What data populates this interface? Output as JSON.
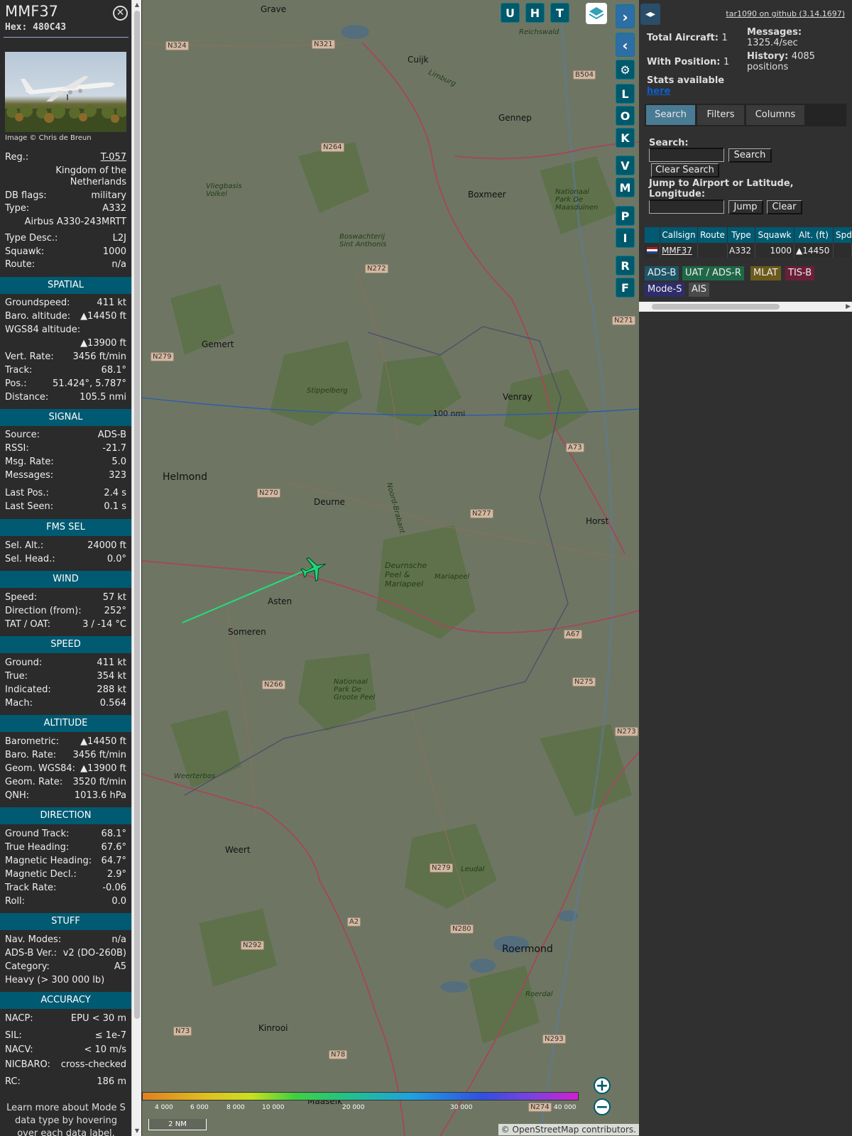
{
  "aircraft": {
    "callsign": "MMF37",
    "hex": "Hex: 480C43",
    "photo_credit": "Image © Chris de Breun"
  },
  "info": {
    "reg": {
      "label": "Reg.:",
      "value": "T-057"
    },
    "country": "Kingdom of the Netherlands",
    "db_flags": {
      "label": "DB flags:",
      "value": "military"
    },
    "type": {
      "label": "Type:",
      "value": "A332"
    },
    "type_full": "Airbus A330-243MRTT",
    "type_desc": {
      "label": "Type Desc.:",
      "value": "L2J"
    },
    "squawk": {
      "label": "Squawk:",
      "value": "1000"
    },
    "route": {
      "label": "Route:",
      "value": "n/a"
    }
  },
  "sections": {
    "spatial": "SPATIAL",
    "signal": "SIGNAL",
    "fms": "FMS SEL",
    "wind": "WIND",
    "speed": "SPEED",
    "altitude": "ALTITUDE",
    "direction": "DIRECTION",
    "stuff": "STUFF",
    "accuracy": "ACCURACY"
  },
  "spatial": {
    "groundspeed": {
      "label": "Groundspeed:",
      "value": "411 kt"
    },
    "baro_alt": {
      "label": "Baro. altitude:",
      "value": "▲14450 ft"
    },
    "wgs84_label": "WGS84 altitude:",
    "wgs84_value": "▲13900 ft",
    "vert_rate": {
      "label": "Vert. Rate:",
      "value": "3456 ft/min"
    },
    "track": {
      "label": "Track:",
      "value": "68.1°"
    },
    "pos": {
      "label": "Pos.:",
      "value": "51.424°, 5.787°"
    },
    "distance": {
      "label": "Distance:",
      "value": "105.5 nmi"
    }
  },
  "signal": {
    "source": {
      "label": "Source:",
      "value": "ADS-B"
    },
    "rssi": {
      "label": "RSSI:",
      "value": "-21.7"
    },
    "msg_rate": {
      "label": "Msg. Rate:",
      "value": "5.0"
    },
    "messages": {
      "label": "Messages:",
      "value": "323"
    },
    "last_pos": {
      "label": "Last Pos.:",
      "value": "2.4 s"
    },
    "last_seen": {
      "label": "Last Seen:",
      "value": "0.1 s"
    }
  },
  "fms": {
    "sel_alt": {
      "label": "Sel. Alt.:",
      "value": "24000 ft"
    },
    "sel_head": {
      "label": "Sel. Head.:",
      "value": "0.0°"
    }
  },
  "wind": {
    "speed": {
      "label": "Speed:",
      "value": "57 kt"
    },
    "direction": {
      "label": "Direction (from):",
      "value": "252°"
    },
    "tat_oat": {
      "label": "TAT / OAT:",
      "value": "3 / -14 °C"
    }
  },
  "speed": {
    "ground": {
      "label": "Ground:",
      "value": "411 kt"
    },
    "true": {
      "label": "True:",
      "value": "354 kt"
    },
    "indicated": {
      "label": "Indicated:",
      "value": "288 kt"
    },
    "mach": {
      "label": "Mach:",
      "value": "0.564"
    }
  },
  "altitude": {
    "barometric": {
      "label": "Barometric:",
      "value": "▲14450 ft"
    },
    "baro_rate": {
      "label": "Baro. Rate:",
      "value": "3456 ft/min"
    },
    "geom_wgs84": {
      "label": "Geom. WGS84:",
      "value": "▲13900 ft"
    },
    "geom_rate": {
      "label": "Geom. Rate:",
      "value": "3520 ft/min"
    },
    "qnh": {
      "label": "QNH:",
      "value": "1013.6 hPa"
    }
  },
  "direction": {
    "ground_track": {
      "label": "Ground Track:",
      "value": "68.1°"
    },
    "true_heading": {
      "label": "True Heading:",
      "value": "67.6°"
    },
    "mag_heading": {
      "label": "Magnetic Heading:",
      "value": "64.7°"
    },
    "mag_decl": {
      "label": "Magnetic Decl.:",
      "value": "2.9°"
    },
    "track_rate": {
      "label": "Track Rate:",
      "value": "-0.06"
    },
    "roll": {
      "label": "Roll:",
      "value": "0.0"
    }
  },
  "stuff": {
    "nav_modes": {
      "label": "Nav. Modes:",
      "value": "n/a"
    },
    "adsb_ver": {
      "label": "ADS-B Ver.:",
      "value": "v2 (DO-260B)"
    },
    "category": {
      "label": "Category:",
      "value": "A5"
    },
    "category_desc": "Heavy (> 300 000 lb)"
  },
  "accuracy": {
    "nacp": {
      "label": "NACP:",
      "value": "EPU < 30 m"
    },
    "sil": {
      "label": "SIL:",
      "value": "≤ 1e-7"
    },
    "nacv": {
      "label": "NACV:",
      "value": "< 10 m/s"
    },
    "nicbaro": {
      "label": "NICBARO:",
      "value": "cross-checked"
    },
    "rc": {
      "label": "RC:",
      "value": "186 m"
    }
  },
  "learn_more": "Learn more about Mode S data type by hovering over each data label.",
  "map": {
    "buttons": {
      "u": "U",
      "h": "H",
      "t": "T",
      "l": "L",
      "o": "O",
      "k": "K",
      "v": "V",
      "m": "M",
      "p": "P",
      "i": "I",
      "r": "R",
      "f": "F"
    },
    "range_ring_label": "100 nmi",
    "scale_label": "2 NM",
    "attribution": "© OpenStreetMap contributors.",
    "altitude_scale": [
      "4 000",
      "6 000",
      "8 000",
      "10 000",
      "20 000",
      "30 000",
      "40 000"
    ],
    "places": {
      "grave": "Grave",
      "cuijk": "Cuijk",
      "gennep": "Gennep",
      "boxmeer": "Boxmeer",
      "venray": "Venray",
      "helmond": "Helmond",
      "deurne": "Deurne",
      "gemert": "Gemert",
      "asten": "Asten",
      "someren": "Someren",
      "horst": "Horst",
      "weert": "Weert",
      "roermond": "Roermond",
      "kinrooi": "Kinrooi",
      "maaseik": "Maaseik",
      "vliegbasis": "Vliegbasis Volkel",
      "stippelberg": "Stippelberg",
      "reichswald": "Reichswald",
      "boswachterij": "Boswachterij Sint Anthonis",
      "nationaal_maas": "Nationaal Park De Maasduinen",
      "deurnsche": "Deurnsche Peel & Mariapeel",
      "mariapeel": "Mariapeel",
      "groote_peel": "Nationaal Park De Groote Peel",
      "weerterbos": "Weerterbos",
      "leudal": "Leudal",
      "roerdal": "Roerdal",
      "limburg": "Limburg",
      "noord_brabant": "Noord-Brabant"
    },
    "roads": {
      "n324": "N324",
      "n321": "N321",
      "n264": "N264",
      "n272": "N272",
      "n279": "N279",
      "n270": "N270",
      "n277": "N277",
      "a73": "A73",
      "n271": "N271",
      "a67": "A67",
      "n275": "N275",
      "n266": "N266",
      "n273": "N273",
      "b504": "B504",
      "n279b": "N279",
      "n280": "N280",
      "a2": "A2",
      "n292": "N292",
      "n73": "N73",
      "n78": "N78",
      "n293": "N293",
      "n274": "N274"
    }
  },
  "sidebar": {
    "github": "tar1090 on github (3.14.1697)",
    "total_aircraft_label": "Total Aircraft:",
    "total_aircraft": "1",
    "with_position_label": "With Position:",
    "with_position": "1",
    "stats_label": "Stats available",
    "stats_link": "here",
    "messages_label": "Messages:",
    "messages_value": "1325.4/sec",
    "history_label": "History:",
    "history_value": "4085",
    "history_unit": "positions",
    "tabs": [
      "Search",
      "Filters",
      "Columns"
    ],
    "search_label": "Search:",
    "search_value": "",
    "search_button": "Search",
    "clear_search_button": "Clear Search",
    "jump_label": "Jump to Airport or Latitude, Longitude:",
    "jump_value": "",
    "jump_button": "Jump",
    "clear_button": "Clear",
    "table": {
      "headers": [
        "Callsign",
        "Route",
        "Type",
        "Squawk",
        "Alt. (ft)",
        "Spd"
      ],
      "row": {
        "callsign": "MMF37",
        "route": "",
        "type": "A332",
        "squawk": "1000",
        "alt": "▲14450"
      }
    },
    "sources": [
      "ADS-B",
      "UAT / ADS-R",
      "MLAT",
      "TIS-B",
      "Mode-S",
      "AIS"
    ],
    "source_colors": [
      "#1d5468",
      "#1f6847",
      "#6b5a1c",
      "#6a1f38",
      "#2f2c6b",
      "#4a4a4a"
    ]
  }
}
